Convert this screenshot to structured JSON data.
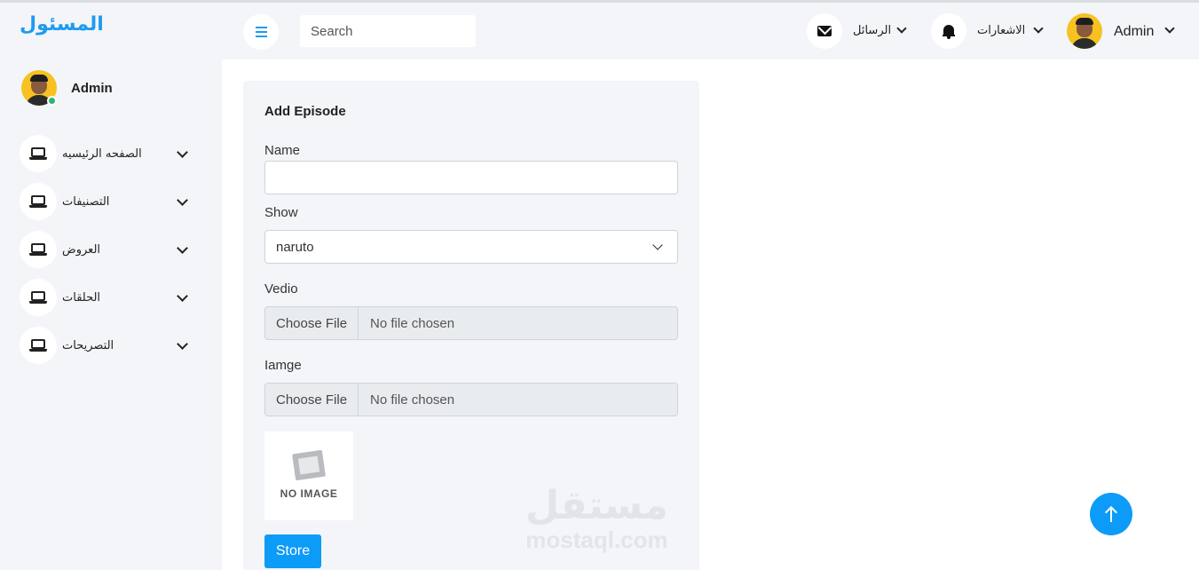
{
  "sidebar": {
    "brand": "المسئول",
    "profile_name": "Admin",
    "items": [
      {
        "label": "الصفحه الرئيسيه"
      },
      {
        "label": "التصنيفات"
      },
      {
        "label": "العروض"
      },
      {
        "label": "الحلقات"
      },
      {
        "label": "التصريحات"
      }
    ]
  },
  "topbar": {
    "search_placeholder": "Search",
    "messages_label": "الرسائل",
    "notifications_label": "الاشعارات",
    "user_name": "Admin"
  },
  "form": {
    "title": "Add Episode",
    "name_label": "Name",
    "name_value": "",
    "show_label": "Show",
    "show_selected": "naruto",
    "video_label": "Vedio",
    "video_button": "Choose File",
    "video_status": "No file chosen",
    "image_label": "Iamge",
    "image_button": "Choose File",
    "image_status": "No file chosen",
    "preview_caption": "NO IMAGE",
    "submit_label": "Store"
  },
  "watermark": {
    "arabic": "مستقل",
    "latin": "mostaql.com"
  },
  "colors": {
    "accent": "#0d9bf8",
    "brand": "#1e9bf0",
    "online": "#2bb673"
  }
}
